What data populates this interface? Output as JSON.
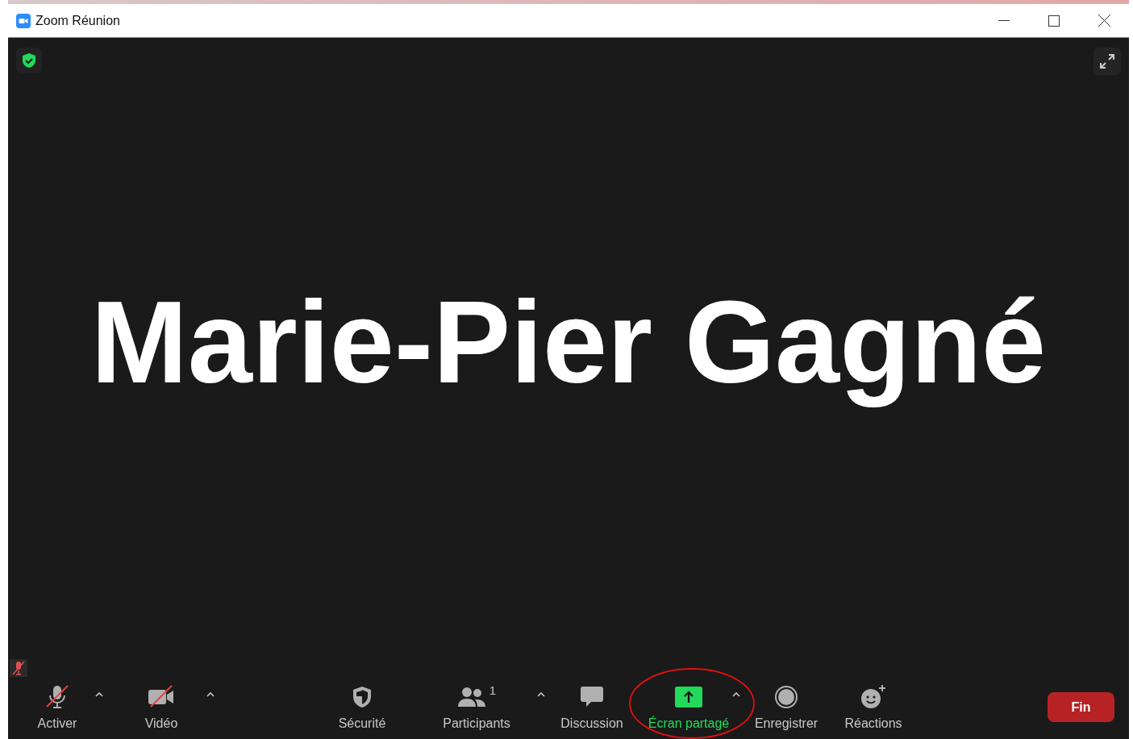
{
  "window": {
    "title": "Zoom Réunion"
  },
  "participant_name": "Marie-Pier Gagné",
  "self_muted": true,
  "toolbar": [
    {
      "kind": "mic",
      "label": "Activer",
      "muted": true,
      "caret": true,
      "highlighted": false
    },
    {
      "kind": "video",
      "label": "Vidéo",
      "muted": true,
      "caret": true,
      "highlighted": false
    },
    {
      "kind": "security",
      "label": "Sécurité",
      "caret": false,
      "highlighted": false
    },
    {
      "kind": "participants",
      "label": "Participants",
      "count": "1",
      "caret": true,
      "highlighted": false
    },
    {
      "kind": "chat",
      "label": "Discussion",
      "caret": false,
      "highlighted": false
    },
    {
      "kind": "share",
      "label": "Écran partagé",
      "caret": true,
      "highlighted": true
    },
    {
      "kind": "record",
      "label": "Enregistrer",
      "caret": false,
      "highlighted": false
    },
    {
      "kind": "reactions",
      "label": "Réactions",
      "caret": false,
      "highlighted": false
    }
  ],
  "end_button": "Fin",
  "annotation": {
    "kind": "ellipse",
    "color": "#e01010"
  }
}
